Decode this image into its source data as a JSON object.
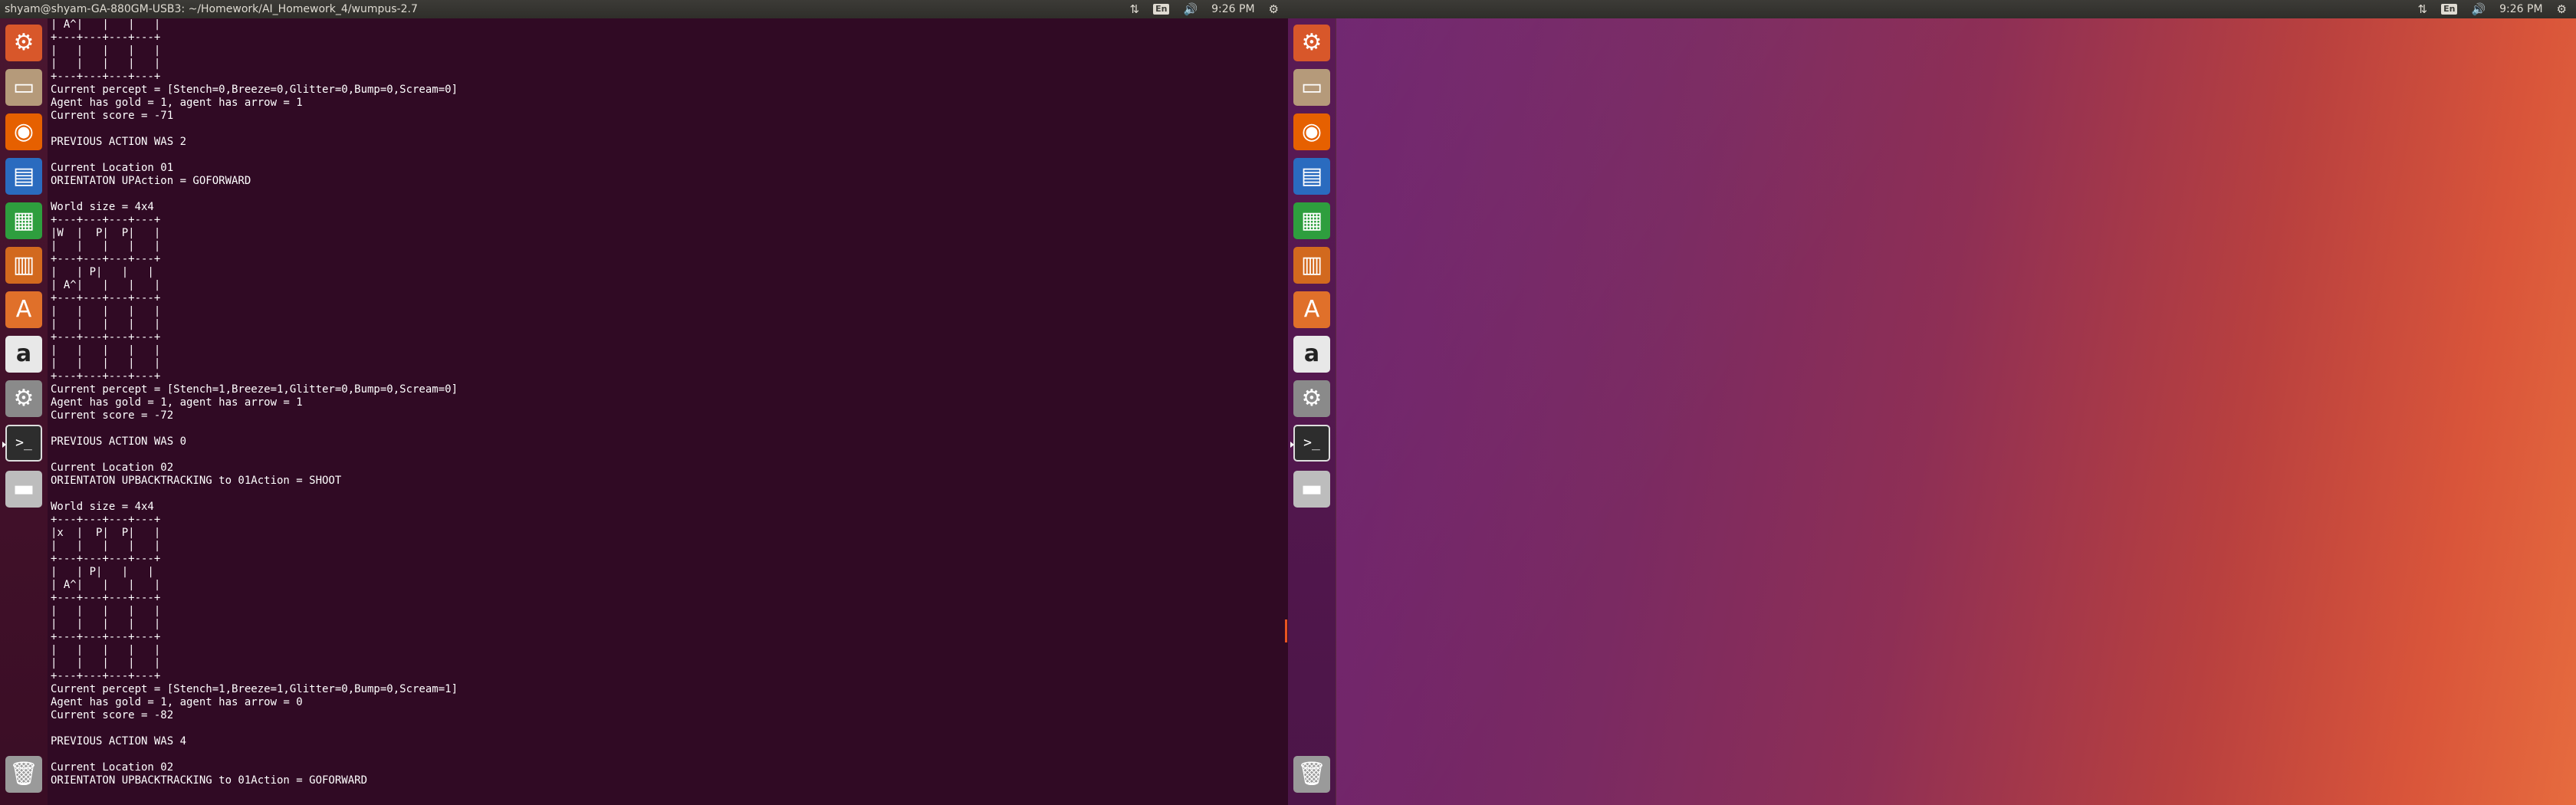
{
  "window": {
    "title": "shyam@shyam-GA-880GM-USB3: ~/Homework/AI_Homework_4/wumpus-2.7"
  },
  "panel": {
    "keyboard_layout": "En",
    "time": "9:26 PM"
  },
  "launcher": [
    {
      "name": "ubuntu-dash-icon",
      "color": "#d8572a",
      "glyph": "⚙"
    },
    {
      "name": "files-icon",
      "color": "#b59a7a",
      "glyph": "▭"
    },
    {
      "name": "firefox-icon",
      "color": "#e66000",
      "glyph": "◉"
    },
    {
      "name": "libreoffice-writer-icon",
      "color": "#2a6bbf",
      "glyph": "▤"
    },
    {
      "name": "libreoffice-calc-icon",
      "color": "#2e9e3e",
      "glyph": "▦"
    },
    {
      "name": "libreoffice-impress-icon",
      "color": "#d2691e",
      "glyph": "▥"
    },
    {
      "name": "ubuntu-software-icon",
      "color": "#e0702a",
      "glyph": "A"
    },
    {
      "name": "amazon-icon",
      "color": "#e8e8e8",
      "glyph": "a"
    },
    {
      "name": "system-settings-icon",
      "color": "#8a8a8a",
      "glyph": "⚙"
    },
    {
      "name": "terminal-icon",
      "color": "#2d2d2d",
      "glyph": ">_"
    },
    {
      "name": "drive-icon",
      "color": "#bdbdbd",
      "glyph": "▬"
    },
    {
      "name": "trash-icon",
      "color": "#9a9a9a",
      "glyph": "🗑"
    }
  ],
  "terminal": {
    "lines": [
      "| A^|   |   |   |",
      "+---+---+---+---+",
      "|   |   |   |   |",
      "|   |   |   |   |",
      "+---+---+---+---+",
      "Current percept = [Stench=0,Breeze=0,Glitter=0,Bump=0,Scream=0]",
      "Agent has gold = 1, agent has arrow = 1",
      "Current score = -71",
      "",
      "PREVIOUS ACTION WAS 2",
      "",
      "Current Location 01",
      "ORIENTATON UPAction = GOFORWARD",
      "",
      "World size = 4x4",
      "+---+---+---+---+",
      "|W  |  P|  P|   |",
      "|   |   |   |   |",
      "+---+---+---+---+",
      "|   | P|   |   |",
      "| A^|   |   |   |",
      "+---+---+---+---+",
      "|   |   |   |   |",
      "|   |   |   |   |",
      "+---+---+---+---+",
      "|   |   |   |   |",
      "|   |   |   |   |",
      "+---+---+---+---+",
      "Current percept = [Stench=1,Breeze=1,Glitter=0,Bump=0,Scream=0]",
      "Agent has gold = 1, agent has arrow = 1",
      "Current score = -72",
      "",
      "PREVIOUS ACTION WAS 0",
      "",
      "Current Location 02",
      "ORIENTATON UPBACKTRACKING to 01Action = SHOOT",
      "",
      "World size = 4x4",
      "+---+---+---+---+",
      "|x  |  P|  P|   |",
      "|   |   |   |   |",
      "+---+---+---+---+",
      "|   | P|   |   |",
      "| A^|   |   |   |",
      "+---+---+---+---+",
      "|   |   |   |   |",
      "|   |   |   |   |",
      "+---+---+---+---+",
      "|   |   |   |   |",
      "|   |   |   |   |",
      "+---+---+---+---+",
      "Current percept = [Stench=1,Breeze=1,Glitter=0,Bump=0,Scream=1]",
      "Agent has gold = 1, agent has arrow = 0",
      "Current score = -82",
      "",
      "PREVIOUS ACTION WAS 4",
      "",
      "Current Location 02",
      "ORIENTATON UPBACKTRACKING to 01Action = GOFORWARD"
    ]
  },
  "colors": {
    "terminal_bg": "#300a24",
    "terminal_fg": "#ffffff",
    "accent": "#e95420"
  }
}
